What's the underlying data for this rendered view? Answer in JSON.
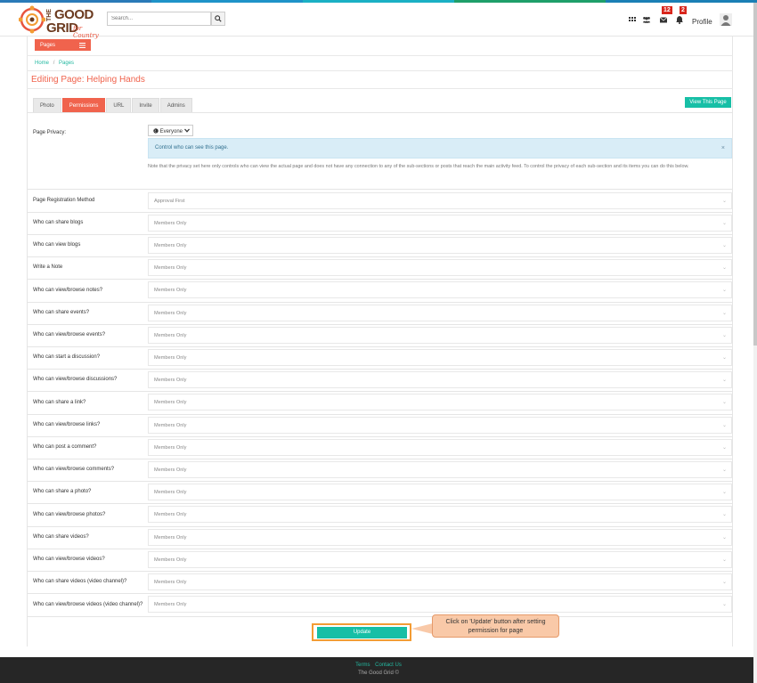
{
  "colors": {
    "accent": "#f0634d",
    "teal": "#17bfa6",
    "stripe": [
      "#2a7ab8",
      "#1f93c8",
      "#1bb0c4",
      "#1f9f6a",
      "#1a7fb5"
    ]
  },
  "logo": {
    "the": "THE",
    "good": "GOOD",
    "grid": "GRID",
    "tagline": "for Country"
  },
  "search": {
    "placeholder": "Search..."
  },
  "header": {
    "icons": [
      "grid-icon",
      "users-icon",
      "envelope-icon",
      "bell-icon"
    ],
    "messages_badge": "12",
    "notifications_badge": "2",
    "profile_label": "Profile"
  },
  "nav": {
    "pages_label": "Pages"
  },
  "breadcrumb": {
    "home": "Home",
    "sep": "/",
    "pages": "Pages"
  },
  "page_title": "Editing Page: Helping Hands",
  "tabs": [
    "Photo",
    "Permissions",
    "URL",
    "Invite",
    "Admins"
  ],
  "active_tab": "Permissions",
  "view_page_label": "View This Page",
  "privacy": {
    "label": "Page Privacy:",
    "value": "Everyone",
    "info": "Control who can see this page.",
    "close": "×",
    "note": "Note that the privacy set here only controls who can view the actual page and does not have any connection to any of the sub-sections or posts that reach the main activity feed. To control the privacy of each sub-section and its items you can do this below."
  },
  "settings": [
    {
      "label": "Page Registration Method",
      "value": "Approval First"
    },
    {
      "label": "Who can share blogs",
      "value": "Members Only"
    },
    {
      "label": "Who can view blogs",
      "value": "Members Only"
    },
    {
      "label": "Write a Note",
      "value": "Members Only"
    },
    {
      "label": "Who can view/browse notes?",
      "value": "Members Only"
    },
    {
      "label": "Who can share events?",
      "value": "Members Only"
    },
    {
      "label": "Who can view/browse events?",
      "value": "Members Only"
    },
    {
      "label": "Who can start a discussion?",
      "value": "Members Only"
    },
    {
      "label": "Who can view/browse discussions?",
      "value": "Members Only"
    },
    {
      "label": "Who can share a link?",
      "value": "Members Only"
    },
    {
      "label": "Who can view/browse links?",
      "value": "Members Only"
    },
    {
      "label": "Who can post a comment?",
      "value": "Members Only"
    },
    {
      "label": "Who can view/browse comments?",
      "value": "Members Only"
    },
    {
      "label": "Who can share a photo?",
      "value": "Members Only"
    },
    {
      "label": "Who can view/browse photos?",
      "value": "Members Only"
    },
    {
      "label": "Who can share videos?",
      "value": "Members Only"
    },
    {
      "label": "Who can view/browse videos?",
      "value": "Members Only"
    },
    {
      "label": "Who can share videos (video channel)?",
      "value": "Members Only"
    },
    {
      "label": "Who can view/browse videos (video channel)?",
      "value": "Members Only"
    }
  ],
  "update_label": "Update",
  "callout": "Click on 'Update' button after setting permission for page",
  "footer": {
    "terms": "Terms",
    "contact": "Contact Us",
    "copyright": "The Good Grid ©"
  }
}
